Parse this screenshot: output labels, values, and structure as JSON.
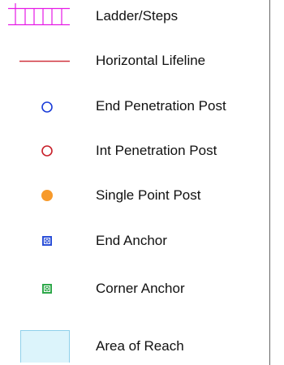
{
  "legend": {
    "items": [
      {
        "icon": "ladder-steps-icon",
        "label": "Ladder/Steps",
        "color": "#e619e6"
      },
      {
        "icon": "horizontal-lifeline-icon",
        "label": "Horizontal Lifeline",
        "color": "#d0343f"
      },
      {
        "icon": "end-penetration-post-icon",
        "label": "End Penetration Post",
        "color": "#1a3cd8"
      },
      {
        "icon": "int-penetration-post-icon",
        "label": "Int Penetration Post",
        "color": "#c8202a"
      },
      {
        "icon": "single-point-post-icon",
        "label": "Single Point Post",
        "color": "#f79a2b"
      },
      {
        "icon": "end-anchor-icon",
        "label": "End Anchor",
        "color": "#2a4ed8"
      },
      {
        "icon": "corner-anchor-icon",
        "label": "Corner Anchor",
        "color": "#2ea84a"
      },
      {
        "icon": "area-of-reach-icon",
        "label": "Area of Reach",
        "color": "#dcf4fb",
        "border_color": "#8fd0ea"
      }
    ]
  }
}
